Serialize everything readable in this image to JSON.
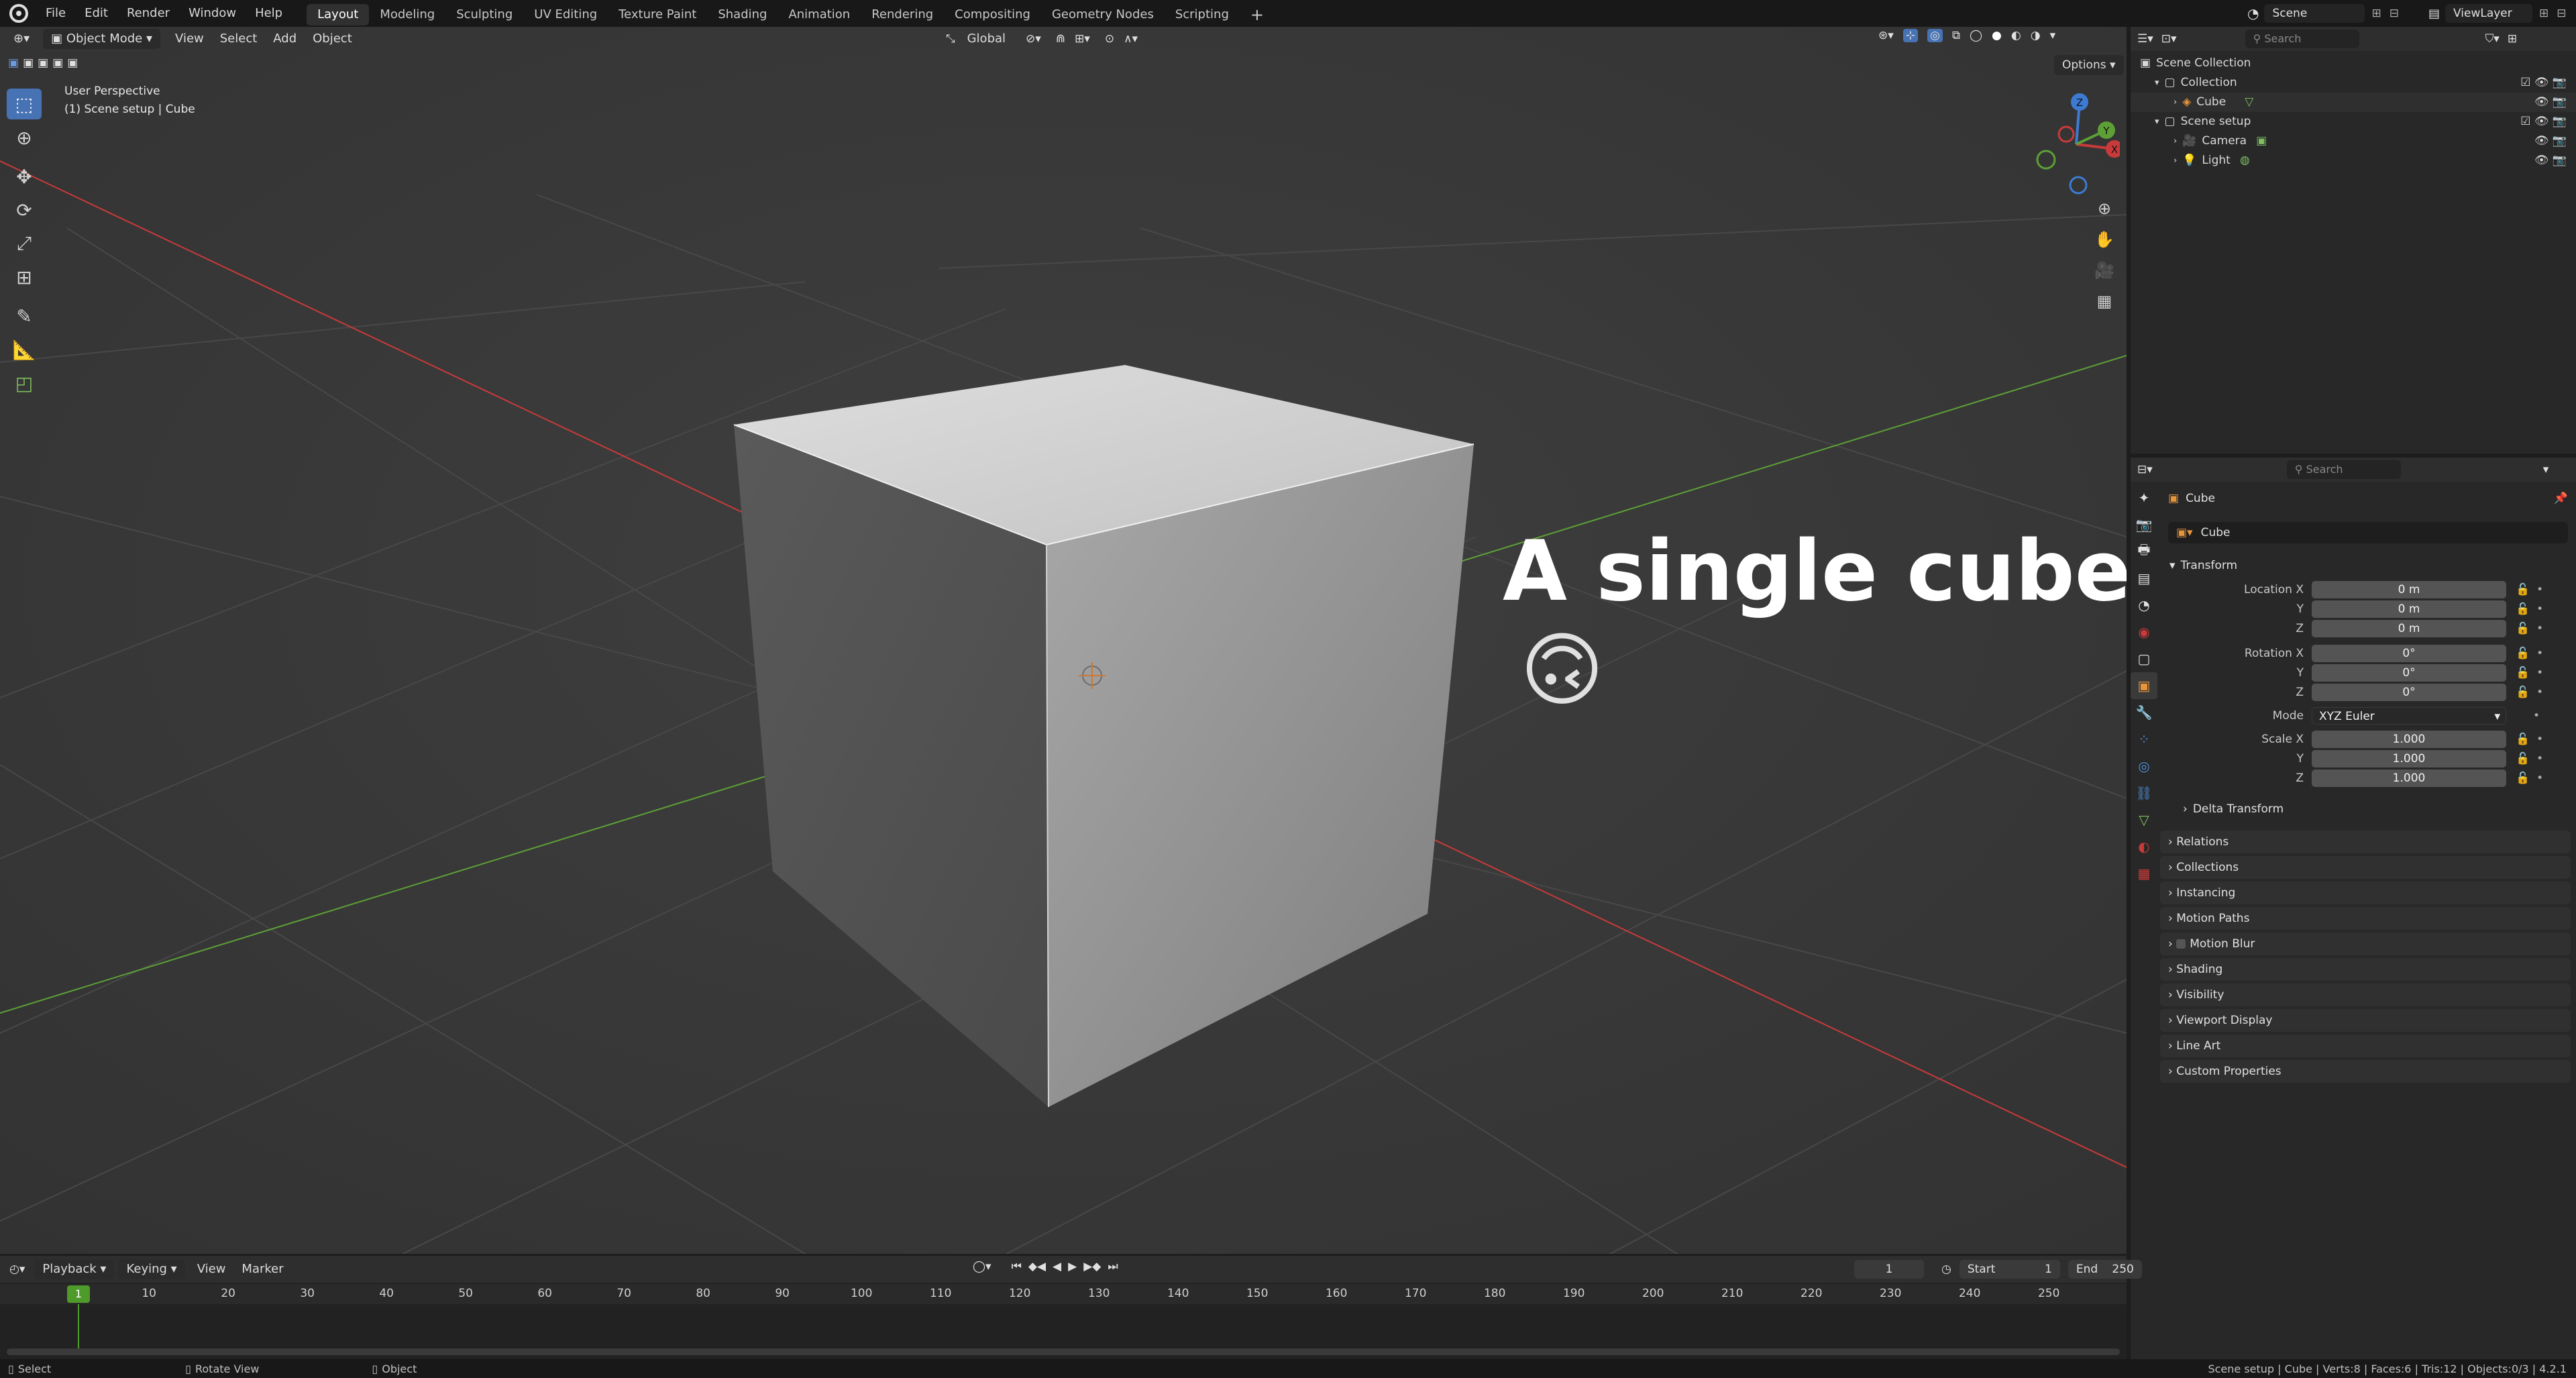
{
  "menubar": {
    "menus": [
      "File",
      "Edit",
      "Render",
      "Window",
      "Help"
    ],
    "workspaces": [
      "Layout",
      "Modeling",
      "Sculpting",
      "UV Editing",
      "Texture Paint",
      "Shading",
      "Animation",
      "Rendering",
      "Compositing",
      "Geometry Nodes",
      "Scripting"
    ],
    "active_workspace": "Layout",
    "add_tab": "+",
    "scene": "Scene",
    "view_layer": "ViewLayer"
  },
  "viewport_header": {
    "mode": "Object Mode",
    "menus": [
      "View",
      "Select",
      "Add",
      "Object"
    ],
    "orientation": "Global",
    "options": "Options"
  },
  "viewport": {
    "perspective": "User Perspective",
    "context": "(1) Scene setup | Cube",
    "overlay_text": "A single cube",
    "overlay_emoji": "🙃",
    "gizmo": {
      "x": "X",
      "y": "Y",
      "z": "Z"
    },
    "colors": {
      "x_axis": "#c93a3a",
      "y_axis": "#5da036",
      "z_axis": "#3d7bd3",
      "cube_light": "#c7c7c7",
      "cube_mid": "#8f8f8f",
      "cube_dark": "#5e5e5e"
    }
  },
  "outliner": {
    "search_placeholder": "Search",
    "scene_collection": "Scene Collection",
    "rows": [
      {
        "label": "Collection",
        "level": 1
      },
      {
        "label": "Cube",
        "level": 2
      },
      {
        "label": "Scene setup",
        "level": 1
      },
      {
        "label": "Camera",
        "level": 2
      },
      {
        "label": "Light",
        "level": 2
      }
    ]
  },
  "properties": {
    "search_placeholder": "Search",
    "object_name": "Cube",
    "name_field": "Cube",
    "transform_header": "Transform",
    "location": {
      "label_x": "Location X",
      "label_y": "Y",
      "label_z": "Z",
      "x": "0 m",
      "y": "0 m",
      "z": "0 m"
    },
    "rotation": {
      "label_x": "Rotation X",
      "label_y": "Y",
      "label_z": "Z",
      "x": "0°",
      "y": "0°",
      "z": "0°"
    },
    "mode": {
      "label": "Mode",
      "value": "XYZ Euler"
    },
    "scale": {
      "label_x": "Scale X",
      "label_y": "Y",
      "label_z": "Z",
      "x": "1.000",
      "y": "1.000",
      "z": "1.000"
    },
    "delta_transform": "Delta Transform",
    "panels": [
      "Relations",
      "Collections",
      "Instancing",
      "Motion Paths",
      "Motion Blur",
      "Shading",
      "Visibility",
      "Viewport Display",
      "Line Art",
      "Custom Properties"
    ]
  },
  "timeline": {
    "menus": [
      "Playback",
      "Keying",
      "View",
      "Marker"
    ],
    "current_frame": "1",
    "start_label": "Start",
    "start": "1",
    "end_label": "End",
    "end": "250",
    "ticks": [
      "10",
      "20",
      "30",
      "40",
      "50",
      "60",
      "70",
      "80",
      "90",
      "100",
      "110",
      "120",
      "130",
      "140",
      "150",
      "160",
      "170",
      "180",
      "190",
      "200",
      "210",
      "220",
      "230",
      "240",
      "250"
    ],
    "playhead": "1"
  },
  "statusbar": {
    "select": "Select",
    "rotate": "Rotate View",
    "object": "Object",
    "stats": "Scene setup | Cube | Verts:8 | Faces:6 | Tris:12 | Objects:0/3 | 4.2.1"
  }
}
